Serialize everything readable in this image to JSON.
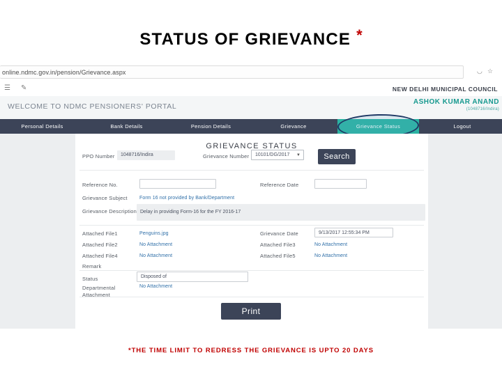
{
  "slide": {
    "title": "STATUS OF GRIEVANCE",
    "title_asterisk": "*",
    "footer_note": "*THE TIME LIMIT TO REDRESS THE GRIEVANCE IS UPTO 20 DAYS",
    "accent_red": "#c00000"
  },
  "browser": {
    "url": "online.ndmc.gov.in/pension/Grievance.aspx",
    "zoom_icon": "zoom-out-icon",
    "bookmark_icon": "star-icon",
    "menu_icon": "hamburger-menu-icon",
    "pen_icon": "edit-pen-icon",
    "council_name": "NEW DELHI MUNICIPAL COUNCIL"
  },
  "portal": {
    "welcome": "WELCOME TO NDMC PENSIONERS' PORTAL",
    "user_name": "ASHOK KUMAR ANAND",
    "user_sub": "(1048716/Indira)",
    "accent_teal": "#17998f",
    "nav": [
      {
        "label": "Personal Details",
        "active": false
      },
      {
        "label": "Bank Details",
        "active": false
      },
      {
        "label": "Pension Details",
        "active": false
      },
      {
        "label": "Grievance",
        "active": false
      },
      {
        "label": "Grievance Status",
        "active": true
      },
      {
        "label": "Logout",
        "active": false
      }
    ]
  },
  "form": {
    "heading": "GRIEVANCE STATUS",
    "ppo_label": "PPO Number",
    "ppo_value": "1048716/Indira",
    "grievance_number_label": "Grievance Number",
    "grievance_number_value": "10101/DG/2017",
    "search_label": "Search",
    "reference_no_label": "Reference No.",
    "reference_no_value": "",
    "reference_date_label": "Reference Date",
    "reference_date_value": "",
    "subject_label": "Grievance Subject",
    "subject_value": "Form 16 not provided by Bank/Department",
    "description_label": "Grievance Description",
    "description_value": "Delay in providing Form-16 for the FY 2016-17",
    "file1_label": "Attached File1",
    "file1_value": "Penguins.jpg",
    "grievance_date_label": "Grievance Date",
    "grievance_date_value": "9/13/2017 12:55:34 PM",
    "file2_label": "Attached File2",
    "file2_value": "No Attachment",
    "file3_label": "Attached File3",
    "file3_value": "No Attachment",
    "file4_label": "Attached File4",
    "file4_value": "No Attachment",
    "file5_label": "Attached File5",
    "file5_value": "No Attachment",
    "remark_label": "Remark",
    "remark_value": "",
    "status_label": "Status",
    "status_value": "Disposed of",
    "dept_attachment_label": "Departmental Attachment",
    "dept_attachment_value": "No Attachment",
    "print_label": "Print"
  }
}
